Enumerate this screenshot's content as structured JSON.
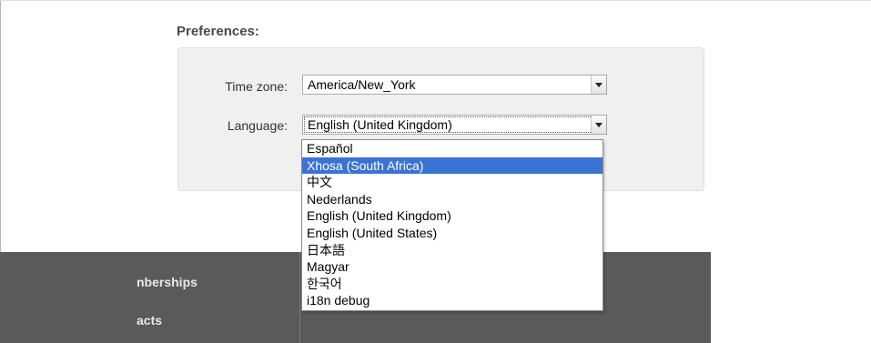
{
  "preferences": {
    "title": "Preferences:",
    "timezone": {
      "label": "Time zone:",
      "value": "America/New_York"
    },
    "language": {
      "label": "Language:",
      "value": "English (United Kingdom)",
      "options": [
        "Español",
        "Xhosa (South Africa)",
        "中文",
        "Nederlands",
        "English (United Kingdom)",
        "English (United States)",
        "日本語",
        "Magyar",
        "한국어",
        "i18n debug"
      ],
      "highlighted": "Xhosa (South Africa)"
    }
  },
  "background_nav": {
    "items": [
      "nberships",
      "acts"
    ]
  },
  "colors": {
    "highlight": "#3b73d4",
    "panel": "#f0f0f0",
    "dark_area": "#5a5a5a"
  },
  "icons": {
    "select_arrow": "chevron-down-icon"
  }
}
